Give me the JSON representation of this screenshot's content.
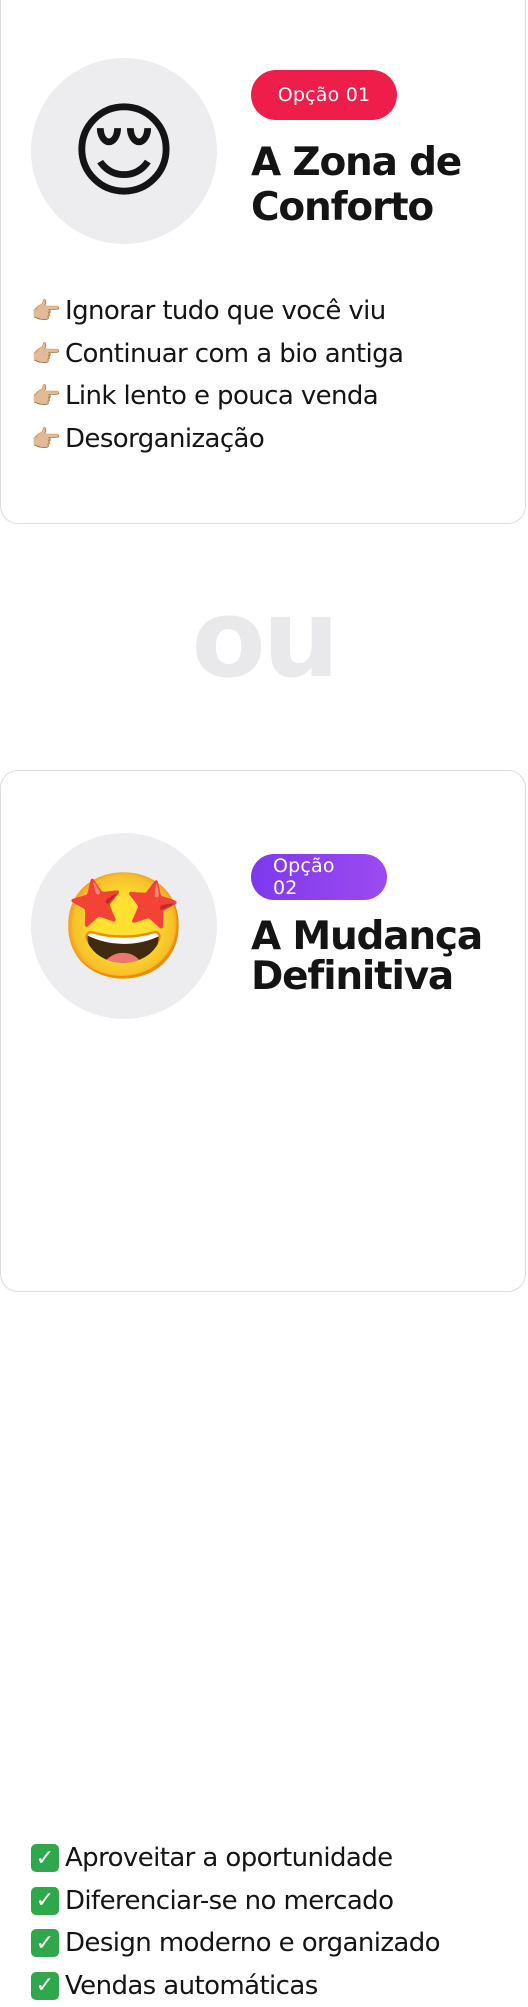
{
  "option1": {
    "badge": "Opção 01",
    "title_line1": "A Zona de",
    "title_line2": "Conforto",
    "emoji": "😌",
    "emoji_icon": "relieved-face-icon",
    "badge_color": "#ee1d4a",
    "items": [
      {
        "icon": "👉🏼",
        "icon_name": "pointing-right-hand-icon",
        "text": "Ignorar tudo que você viu"
      },
      {
        "icon": "👉🏼",
        "icon_name": "pointing-right-hand-icon",
        "text": "Continuar com a bio antiga"
      },
      {
        "icon": "👉🏼",
        "icon_name": "pointing-right-hand-icon",
        "text": "Link lento e pouca venda"
      },
      {
        "icon": "👉🏼",
        "icon_name": "pointing-right-hand-icon",
        "text": "Desorganização"
      }
    ]
  },
  "divider_text": "ou",
  "option2": {
    "badge": "Opção 02",
    "title_line1": "A Mudança",
    "title_line2": "Definitiva",
    "emoji": "🤩",
    "emoji_icon": "star-struck-face-icon",
    "badge_color": "#7c3aed",
    "items": [
      {
        "icon": "✓",
        "icon_name": "check-mark-icon",
        "text": "Aproveitar a oportunidade"
      },
      {
        "icon": "✓",
        "icon_name": "check-mark-icon",
        "text": "Diferenciar-se no mercado"
      },
      {
        "icon": "✓",
        "icon_name": "check-mark-icon",
        "text": "Design moderno e organizado"
      },
      {
        "icon": "✓",
        "icon_name": "check-mark-icon",
        "text": "Vendas automáticas"
      }
    ]
  }
}
